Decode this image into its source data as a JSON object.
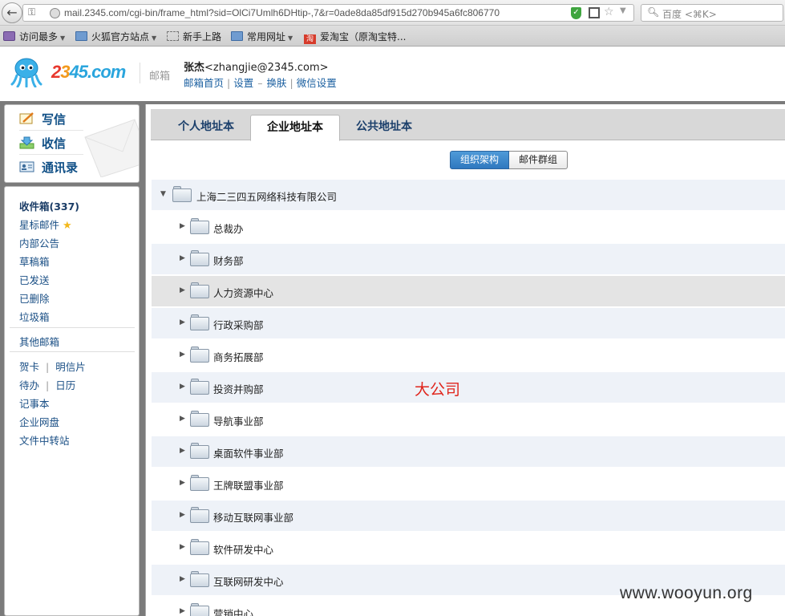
{
  "browser": {
    "url": "mail.2345.com/cgi-bin/frame_html?sid=OlCi7Umlh6DHtip-,7&r=0ade8da85df915d270b945a6fc806770",
    "search_placeholder": "百度 <⌘K>",
    "bookmarks": [
      "访问最多",
      "火狐官方站点",
      "新手上路",
      "常用网址",
      "爱淘宝（原淘宝特..."
    ],
    "taobao_icon_text": "淘"
  },
  "header": {
    "logo_parts": [
      "2",
      "3",
      "45",
      ".com"
    ],
    "logo_sub": "邮箱",
    "user_name": "张杰",
    "user_email": "<zhangjie@2345.com>",
    "links": [
      "邮箱首页",
      "设置",
      "换肤",
      "微信设置"
    ],
    "link_separator": "|",
    "link_dash": "–"
  },
  "sidebar": {
    "actions": [
      "写信",
      "收信",
      "通讯录"
    ],
    "inbox": "收件箱(337)",
    "folders": [
      "星标邮件",
      "内部公告",
      "草稿箱",
      "已发送",
      "已删除",
      "垃圾箱"
    ],
    "other": "其他邮箱",
    "tools_pairs": [
      [
        "贺卡",
        "明信片"
      ],
      [
        "待办",
        "日历"
      ]
    ],
    "tools": [
      "记事本",
      "企业网盘",
      "文件中转站"
    ],
    "pair_separator": "|"
  },
  "main": {
    "tabs": [
      "个人地址本",
      "企业地址本",
      "公共地址本"
    ],
    "active_tab": 1,
    "view_toggle": [
      "组织架构",
      "邮件群组"
    ],
    "root": "上海二三四五网络科技有限公司",
    "departments": [
      "总裁办",
      "财务部",
      "人力资源中心",
      "行政采购部",
      "商务拓展部",
      "投资并购部",
      "导航事业部",
      "桌面软件事业部",
      "王牌联盟事业部",
      "移动互联网事业部",
      "软件研发中心",
      "互联网研发中心",
      "营销中心"
    ],
    "annotation": "大公司"
  },
  "watermark": "www.wooyun.org",
  "colors": {
    "accent": "#2f78bf",
    "annotation": "#e0241b",
    "link": "#1a5fa0"
  }
}
